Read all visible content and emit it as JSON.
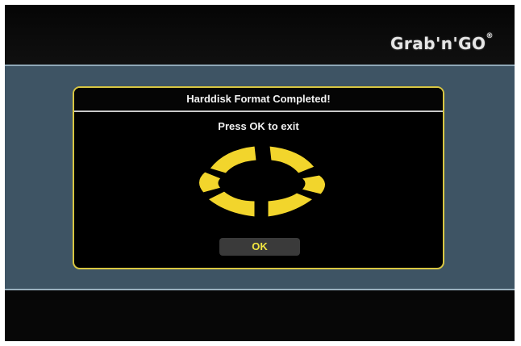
{
  "brand": {
    "logo_text": "Grab'n'GO",
    "logo_mark": "®"
  },
  "dialog": {
    "title": "Harddisk Format Completed!",
    "message": "Press OK to exit",
    "ok_label": "OK",
    "icon": "format-progress-ring-icon"
  },
  "colors": {
    "accent_yellow": "#f2d52c",
    "dialog_border": "#d8c642",
    "mid_band": "#3e5464"
  }
}
